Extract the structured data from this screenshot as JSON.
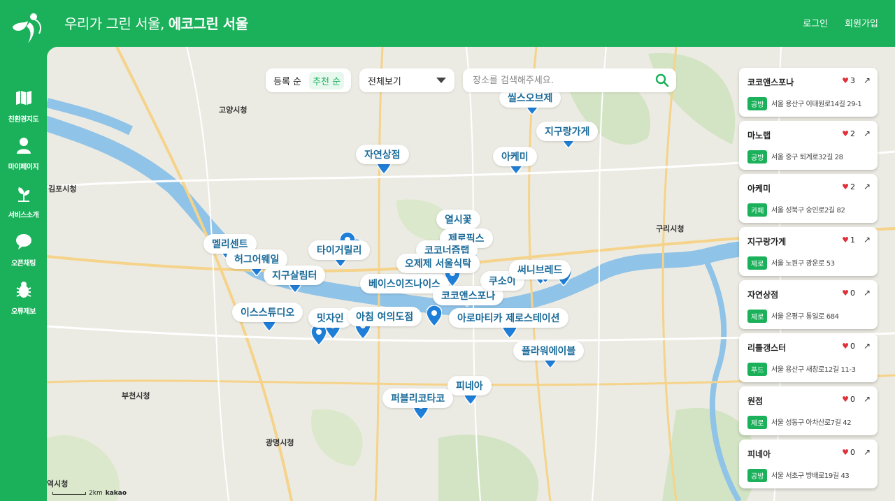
{
  "header": {
    "title_prefix": "우리가 그린 서울, ",
    "title_strong": "에코그린 서울",
    "login": "로그인",
    "signup": "회원가입"
  },
  "sidebar": {
    "items": [
      {
        "label": "친환경지도",
        "icon": "map-icon"
      },
      {
        "label": "마이페이지",
        "icon": "user-icon"
      },
      {
        "label": "서비스소개",
        "icon": "leaf-icon"
      },
      {
        "label": "오픈채팅",
        "icon": "chat-icon"
      },
      {
        "label": "오류제보",
        "icon": "bug-icon"
      }
    ]
  },
  "controls": {
    "sort_registered": "등록 순",
    "sort_recommended": "추천 순",
    "filter_selected": "전체보기",
    "search_placeholder": "장소를 검색해주세요."
  },
  "map": {
    "city_labels": [
      "고양시청",
      "김포시청",
      "부천시청",
      "광명시청",
      "구리시청",
      "역시청"
    ],
    "place_labels": [
      "자연상점",
      "아케미",
      "지구랑가게",
      "열시꽃",
      "제로픽스",
      "멜리센트",
      "허그어웨일",
      "타이거릴리",
      "코코너즘랩",
      "지구살림터",
      "베이스이즈나이스",
      "코코앤스포나",
      "쿠소이",
      "써니브레드",
      "이스스튜디오",
      "밋자인",
      "아침 여의도점",
      "아로마티카 제로스테이션",
      "플라워에이블",
      "피네아",
      "퍼블리코타코",
      "씰스오브제",
      "오제제 서울식탁"
    ],
    "scale_text": "2km",
    "kakao": "kakao"
  },
  "cards": [
    {
      "name": "코코앤스포나",
      "likes": "3",
      "tag": "공방",
      "address": "서울 용산구 이태원로14길 29-1"
    },
    {
      "name": "마노랩",
      "likes": "2",
      "tag": "공방",
      "address": "서울 중구 퇴계로32길 28"
    },
    {
      "name": "아케미",
      "likes": "2",
      "tag": "카페",
      "address": "서울 성북구 숭인로2길 82"
    },
    {
      "name": "지구랑가게",
      "likes": "1",
      "tag": "제로",
      "address": "서울 노원구 광운로 53"
    },
    {
      "name": "자연상점",
      "likes": "0",
      "tag": "제로",
      "address": "서울 은평구 통일로 684"
    },
    {
      "name": "리틀갱스터",
      "likes": "0",
      "tag": "푸드",
      "address": "서울 용산구 새창로12길 11-3"
    },
    {
      "name": "원점",
      "likes": "0",
      "tag": "제로",
      "address": "서울 성동구 아차산로7길 42"
    },
    {
      "name": "피네아",
      "likes": "0",
      "tag": "공방",
      "address": "서울 서초구 방배로19길 43"
    }
  ],
  "colors": {
    "brand": "#1ab15a",
    "river": "#8fc3e8",
    "heart": "#e0303a"
  }
}
